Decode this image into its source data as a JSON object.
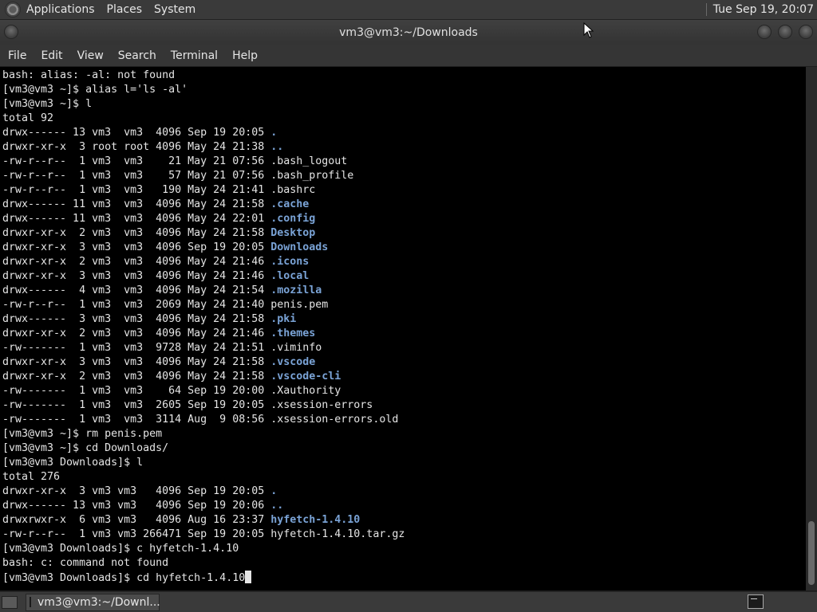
{
  "top_panel": {
    "menus": [
      "Applications",
      "Places",
      "System"
    ],
    "clock": "Tue Sep 19, 20:07"
  },
  "window": {
    "title": "vm3@vm3:~/Downloads"
  },
  "menubar": [
    "File",
    "Edit",
    "View",
    "Search",
    "Terminal",
    "Help"
  ],
  "terminal": {
    "lines": [
      [
        {
          "t": "bash: alias: -al: not found"
        }
      ],
      [
        {
          "t": "[vm3@vm3 ~]$ alias l='ls -al'"
        }
      ],
      [
        {
          "t": "[vm3@vm3 ~]$ l"
        }
      ],
      [
        {
          "t": "total 92"
        }
      ],
      [
        {
          "t": "drwx------ 13 vm3  vm3  4096 Sep 19 20:05 "
        },
        {
          "t": ".",
          "c": "dir"
        }
      ],
      [
        {
          "t": "drwxr-xr-x  3 root root 4096 May 24 21:38 "
        },
        {
          "t": "..",
          "c": "dir"
        }
      ],
      [
        {
          "t": "-rw-r--r--  1 vm3  vm3    21 May 21 07:56 .bash_logout"
        }
      ],
      [
        {
          "t": "-rw-r--r--  1 vm3  vm3    57 May 21 07:56 .bash_profile"
        }
      ],
      [
        {
          "t": "-rw-r--r--  1 vm3  vm3   190 May 24 21:41 .bashrc"
        }
      ],
      [
        {
          "t": "drwx------ 11 vm3  vm3  4096 May 24 21:58 "
        },
        {
          "t": ".cache",
          "c": "dir"
        }
      ],
      [
        {
          "t": "drwx------ 11 vm3  vm3  4096 May 24 22:01 "
        },
        {
          "t": ".config",
          "c": "dir"
        }
      ],
      [
        {
          "t": "drwxr-xr-x  2 vm3  vm3  4096 May 24 21:58 "
        },
        {
          "t": "Desktop",
          "c": "dir"
        }
      ],
      [
        {
          "t": "drwxr-xr-x  3 vm3  vm3  4096 Sep 19 20:05 "
        },
        {
          "t": "Downloads",
          "c": "dir"
        }
      ],
      [
        {
          "t": "drwxr-xr-x  2 vm3  vm3  4096 May 24 21:46 "
        },
        {
          "t": ".icons",
          "c": "dir"
        }
      ],
      [
        {
          "t": "drwxr-xr-x  3 vm3  vm3  4096 May 24 21:46 "
        },
        {
          "t": ".local",
          "c": "dir"
        }
      ],
      [
        {
          "t": "drwx------  4 vm3  vm3  4096 May 24 21:54 "
        },
        {
          "t": ".mozilla",
          "c": "dir"
        }
      ],
      [
        {
          "t": "-rw-r--r--  1 vm3  vm3  2069 May 24 21:40 penis.pem"
        }
      ],
      [
        {
          "t": "drwx------  3 vm3  vm3  4096 May 24 21:58 "
        },
        {
          "t": ".pki",
          "c": "dir"
        }
      ],
      [
        {
          "t": "drwxr-xr-x  2 vm3  vm3  4096 May 24 21:46 "
        },
        {
          "t": ".themes",
          "c": "dir"
        }
      ],
      [
        {
          "t": "-rw-------  1 vm3  vm3  9728 May 24 21:51 .viminfo"
        }
      ],
      [
        {
          "t": "drwxr-xr-x  3 vm3  vm3  4096 May 24 21:58 "
        },
        {
          "t": ".vscode",
          "c": "dir"
        }
      ],
      [
        {
          "t": "drwxr-xr-x  2 vm3  vm3  4096 May 24 21:58 "
        },
        {
          "t": ".vscode-cli",
          "c": "dir"
        }
      ],
      [
        {
          "t": "-rw-------  1 vm3  vm3    64 Sep 19 20:00 .Xauthority"
        }
      ],
      [
        {
          "t": "-rw-------  1 vm3  vm3  2605 Sep 19 20:05 .xsession-errors"
        }
      ],
      [
        {
          "t": "-rw-------  1 vm3  vm3  3114 Aug  9 08:56 .xsession-errors.old"
        }
      ],
      [
        {
          "t": "[vm3@vm3 ~]$ rm penis.pem"
        }
      ],
      [
        {
          "t": "[vm3@vm3 ~]$ cd Downloads/"
        }
      ],
      [
        {
          "t": "[vm3@vm3 Downloads]$ l"
        }
      ],
      [
        {
          "t": "total 276"
        }
      ],
      [
        {
          "t": "drwxr-xr-x  3 vm3 vm3   4096 Sep 19 20:05 "
        },
        {
          "t": ".",
          "c": "dir"
        }
      ],
      [
        {
          "t": "drwx------ 13 vm3 vm3   4096 Sep 19 20:06 "
        },
        {
          "t": "..",
          "c": "dir"
        }
      ],
      [
        {
          "t": "drwxrwxr-x  6 vm3 vm3   4096 Aug 16 23:37 "
        },
        {
          "t": "hyfetch-1.4.10",
          "c": "dir"
        }
      ],
      [
        {
          "t": "-rw-r--r--  1 vm3 vm3 266471 Sep 19 20:05 hyfetch-1.4.10.tar.gz"
        }
      ],
      [
        {
          "t": "[vm3@vm3 Downloads]$ c hyfetch-1.4.10"
        }
      ],
      [
        {
          "t": "bash: c: command not found"
        }
      ],
      [
        {
          "t": "[vm3@vm3 Downloads]$ cd hyfetch-1.4.10"
        },
        {
          "cursor": true
        }
      ]
    ]
  },
  "taskbar": {
    "window_button": "vm3@vm3:~/Downl..."
  }
}
